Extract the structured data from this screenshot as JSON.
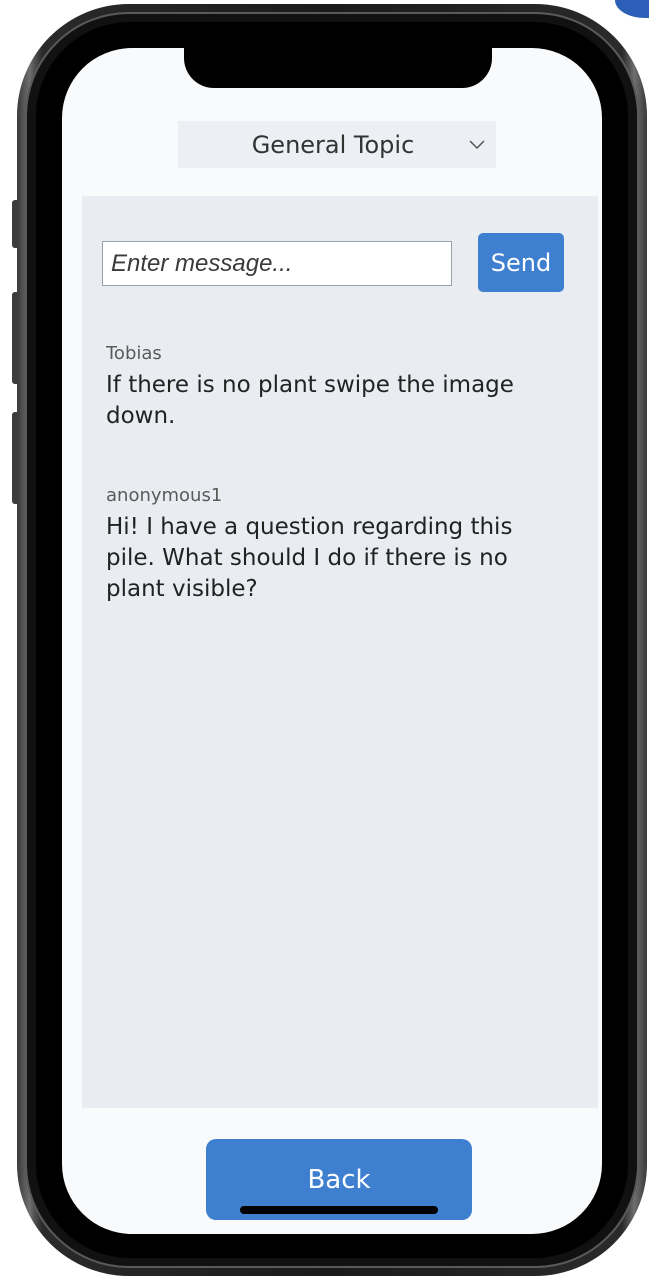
{
  "topic_select": {
    "selected": "General Topic",
    "icon": "chevron-down-icon"
  },
  "composer": {
    "placeholder": "Enter message...",
    "value": "",
    "send_label": "Send"
  },
  "messages": [
    {
      "author": "Tobias",
      "text": "If there is no plant swipe the image down."
    },
    {
      "author": "anonymous1",
      "text": "Hi! I have a question regarding this pile. What should I do if there is no plant visible?"
    }
  ],
  "footer": {
    "back_label": "Back"
  },
  "colors": {
    "accent": "#3f7fd0",
    "panel": "#e9edf2",
    "select_bg": "#eceff3",
    "screen_bg": "#f9fafb",
    "corner_accent": "#2b5fb8"
  }
}
